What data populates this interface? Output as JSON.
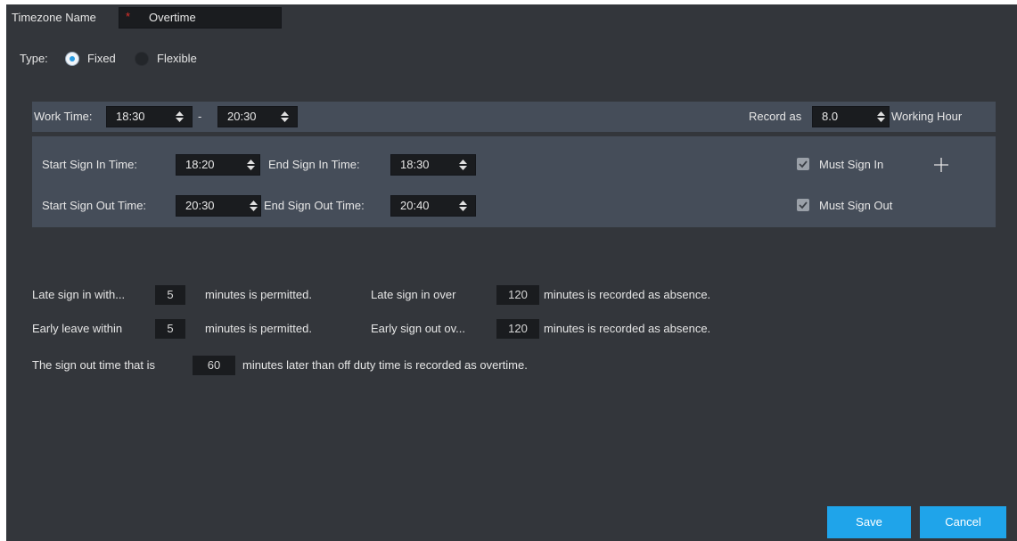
{
  "header": {
    "timezone_label": "Timezone Name",
    "required_mark": "*",
    "timezone_value": "Overtime"
  },
  "type": {
    "label": "Type:",
    "options": [
      {
        "label": "Fixed",
        "selected": true
      },
      {
        "label": "Flexible",
        "selected": false
      }
    ]
  },
  "work_time": {
    "label": "Work Time:",
    "start": "18:30",
    "separator": "-",
    "end": "20:30",
    "record_as_label": "Record as",
    "record_value": "8.0",
    "unit_label": "Working Hour"
  },
  "sign": {
    "start_in_label": "Start Sign In Time:",
    "start_in_value": "18:20",
    "end_in_label": "End Sign In Time:",
    "end_in_value": "18:30",
    "must_sign_in_label": "Must Sign In",
    "must_sign_in_checked": true,
    "start_out_label": "Start Sign Out Time:",
    "start_out_value": "20:30",
    "end_out_label": "End Sign Out Time:",
    "end_out_value": "20:40",
    "must_sign_out_label": "Must Sign Out",
    "must_sign_out_checked": true,
    "add_icon": "plus-icon"
  },
  "rules": {
    "late_label": "Late sign in with...",
    "late_value": "5",
    "late_suffix": "minutes is permitted.",
    "late_over_label": "Late sign in over",
    "late_over_value": "120",
    "late_over_suffix": "minutes is recorded as absence.",
    "early_label": "Early leave within",
    "early_value": "5",
    "early_suffix": "minutes is permitted.",
    "early_over_label": "Early sign out ov...",
    "early_over_value": "120",
    "early_over_suffix": "minutes is recorded as absence.",
    "overtime_prefix": "The sign out time that is",
    "overtime_value": "60",
    "overtime_suffix": "minutes later than off duty time is recorded as overtime."
  },
  "footer": {
    "save_label": "Save",
    "cancel_label": "Cancel"
  },
  "colors": {
    "background": "#33363b",
    "panel": "#454d59",
    "field": "#1a1c1f",
    "accent": "#1fa4ea",
    "required": "#e0302a"
  }
}
